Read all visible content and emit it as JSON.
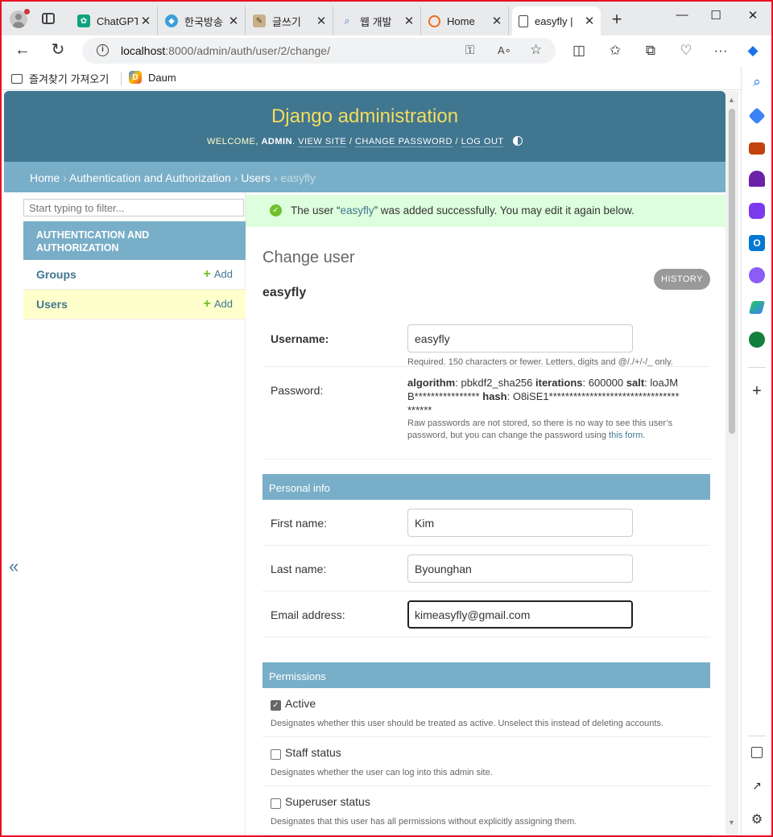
{
  "browser": {
    "tabs": [
      {
        "title": "ChatGPT",
        "icon": "chatgpt-icon",
        "color": "#10a37f"
      },
      {
        "title": "한국방송",
        "icon": "broadcast-icon",
        "color": "#3aa0d8"
      },
      {
        "title": "글쓰기",
        "icon": "writing-icon",
        "color": "#8a6d3b"
      },
      {
        "title": "웹 개발",
        "icon": "search-icon",
        "color": "#4a7bd8"
      },
      {
        "title": "Home",
        "icon": "home-logo-icon",
        "color": "#ef6c1a"
      },
      {
        "title": "easyfly |",
        "icon": "page-icon",
        "color": "#444444",
        "active": true
      }
    ],
    "url_host": "localhost",
    "url_path": ":8000/admin/auth/user/2/change/",
    "favorites": [
      {
        "label": "즐겨찾기 가져오기",
        "icon": "import-favorites-icon"
      },
      {
        "label": "Daum",
        "icon": "daum-icon"
      }
    ]
  },
  "header": {
    "site_title": "Django administration",
    "welcome": "Welcome,",
    "username": "admin",
    "view_site": "View site",
    "change_password": "Change password",
    "log_out": "Log out"
  },
  "breadcrumbs": {
    "home": "Home",
    "app": "Authentication and Authorization",
    "model": "Users",
    "current": "easyfly"
  },
  "nav": {
    "filter_placeholder": "Start typing to filter...",
    "app_caption": "Authentication and Authorization",
    "models": [
      {
        "name": "Groups",
        "add": "Add"
      },
      {
        "name": "Users",
        "add": "Add",
        "current": true
      }
    ],
    "collapse": "«"
  },
  "message": {
    "before": "The user “",
    "link": "easyfly",
    "after": "” was added successfully. You may edit it again below."
  },
  "content": {
    "title": "Change user",
    "object": "easyfly",
    "history": "History",
    "username_label": "Username:",
    "username_value": "easyfly",
    "username_help": "Required. 150 characters or fewer. Letters, digits and @/./+/-/_ only.",
    "password_label": "Password:",
    "password": {
      "algorithm_key": "algorithm",
      "algorithm_val": "pbkdf2_sha256",
      "iterations_key": "iterations",
      "iterations_val": "600000",
      "salt_key": "salt",
      "salt_val": "loaJMB****************",
      "hash_key": "hash",
      "hash_val": "O8iSE1**************************************"
    },
    "password_help_1": "Raw passwords are not stored, so there is no way to see this user’s password, but you can change the password using",
    "password_help_link": "this form",
    "personal_info": "Personal info",
    "first_name_label": "First name:",
    "first_name_value": "Kim",
    "last_name_label": "Last name:",
    "last_name_value": "Byounghan",
    "email_label": "Email address:",
    "email_value": "kimeasyfly@gmail.com",
    "permissions": "Permissions",
    "active_label": "Active",
    "active_checked": true,
    "active_help": "Designates whether this user should be treated as active. Unselect this instead of deleting accounts.",
    "staff_label": "Staff status",
    "staff_checked": false,
    "staff_help": "Designates whether the user can log into this admin site.",
    "superuser_label": "Superuser status",
    "superuser_checked": false,
    "superuser_help": "Designates that this user has all permissions without explicitly assigning them."
  },
  "colors": {
    "header_bg": "#417690",
    "breadcrumb_bg": "#79aec8",
    "title_yellow": "#f5dd5d",
    "success_bg": "#dddddd",
    "link": "#417690",
    "add_green": "#70bf2b"
  }
}
